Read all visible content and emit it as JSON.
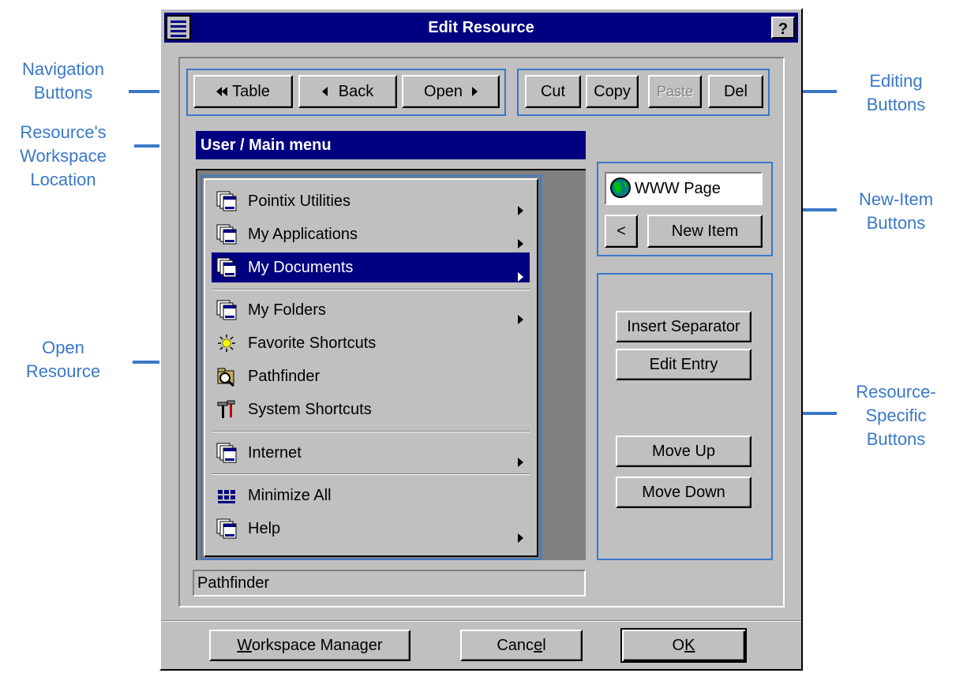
{
  "annotations": {
    "navigation": [
      "Navigation",
      "Buttons"
    ],
    "editing": [
      "Editing",
      "Buttons"
    ],
    "location": [
      "Resource's",
      "Workspace",
      "Location"
    ],
    "new_item": [
      "New-Item",
      "Buttons"
    ],
    "open_resource": [
      "Open",
      "Resource"
    ],
    "resource_specific": [
      "Resource-",
      "Specific",
      "Buttons"
    ]
  },
  "window": {
    "title": "Edit Resource",
    "help": "?"
  },
  "nav": {
    "table": "Table",
    "back": "Back",
    "open": "Open"
  },
  "edit": {
    "cut": "Cut",
    "copy": "Copy",
    "paste": "Paste",
    "del": "Del"
  },
  "location": "User / Main menu",
  "menu": [
    {
      "label": "Pointix Utilities",
      "icon": "window-stack-icon",
      "submenu": true
    },
    {
      "label": "My Applications",
      "icon": "window-stack-icon",
      "submenu": true
    },
    {
      "label": "My Documents",
      "icon": "window-stack-icon",
      "submenu": true,
      "selected": true
    },
    {
      "label": "My Folders",
      "icon": "window-stack-icon",
      "submenu": true
    },
    {
      "label": "Favorite Shortcuts",
      "icon": "sun-icon",
      "submenu": false
    },
    {
      "label": "Pathfinder",
      "icon": "pathfinder-icon",
      "submenu": false
    },
    {
      "label": "System Shortcuts",
      "icon": "tools-icon",
      "submenu": false
    },
    {
      "label": "Internet",
      "icon": "window-stack-icon",
      "submenu": true
    },
    {
      "label": "Minimize All",
      "icon": "minimize-all-icon",
      "submenu": false
    },
    {
      "label": "Help",
      "icon": "window-stack-icon",
      "submenu": true
    }
  ],
  "status": "Pathfinder",
  "new_item": {
    "type": "WWW Page",
    "prev": "<",
    "button": "New Item"
  },
  "resource_buttons": {
    "insert_separator": "Insert Separator",
    "edit_entry": "Edit Entry",
    "move_up": "Move Up",
    "move_down": "Move Down"
  },
  "footer": {
    "workspace_manager_u": "W",
    "workspace_manager_rest": "orkspace Manager",
    "cancel_a": "Canc",
    "cancel_u": "e",
    "cancel_b": "l",
    "ok_a": "O",
    "ok_u": "K"
  },
  "colors": {
    "annotation": "#3a78c8",
    "titlebar": "#000080",
    "face": "#c0c0c0"
  }
}
